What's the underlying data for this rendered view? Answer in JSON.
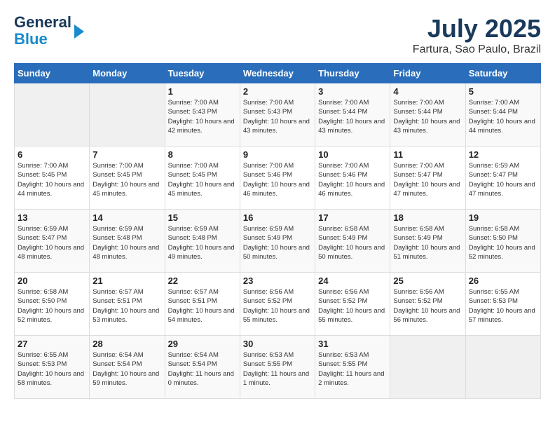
{
  "header": {
    "logo_line1": "General",
    "logo_line2": "Blue",
    "month": "July 2025",
    "location": "Fartura, Sao Paulo, Brazil"
  },
  "weekdays": [
    "Sunday",
    "Monday",
    "Tuesday",
    "Wednesday",
    "Thursday",
    "Friday",
    "Saturday"
  ],
  "weeks": [
    [
      {
        "day": "",
        "info": ""
      },
      {
        "day": "",
        "info": ""
      },
      {
        "day": "1",
        "info": "Sunrise: 7:00 AM\nSunset: 5:43 PM\nDaylight: 10 hours and 42 minutes."
      },
      {
        "day": "2",
        "info": "Sunrise: 7:00 AM\nSunset: 5:43 PM\nDaylight: 10 hours and 43 minutes."
      },
      {
        "day": "3",
        "info": "Sunrise: 7:00 AM\nSunset: 5:44 PM\nDaylight: 10 hours and 43 minutes."
      },
      {
        "day": "4",
        "info": "Sunrise: 7:00 AM\nSunset: 5:44 PM\nDaylight: 10 hours and 43 minutes."
      },
      {
        "day": "5",
        "info": "Sunrise: 7:00 AM\nSunset: 5:44 PM\nDaylight: 10 hours and 44 minutes."
      }
    ],
    [
      {
        "day": "6",
        "info": "Sunrise: 7:00 AM\nSunset: 5:45 PM\nDaylight: 10 hours and 44 minutes."
      },
      {
        "day": "7",
        "info": "Sunrise: 7:00 AM\nSunset: 5:45 PM\nDaylight: 10 hours and 45 minutes."
      },
      {
        "day": "8",
        "info": "Sunrise: 7:00 AM\nSunset: 5:45 PM\nDaylight: 10 hours and 45 minutes."
      },
      {
        "day": "9",
        "info": "Sunrise: 7:00 AM\nSunset: 5:46 PM\nDaylight: 10 hours and 46 minutes."
      },
      {
        "day": "10",
        "info": "Sunrise: 7:00 AM\nSunset: 5:46 PM\nDaylight: 10 hours and 46 minutes."
      },
      {
        "day": "11",
        "info": "Sunrise: 7:00 AM\nSunset: 5:47 PM\nDaylight: 10 hours and 47 minutes."
      },
      {
        "day": "12",
        "info": "Sunrise: 6:59 AM\nSunset: 5:47 PM\nDaylight: 10 hours and 47 minutes."
      }
    ],
    [
      {
        "day": "13",
        "info": "Sunrise: 6:59 AM\nSunset: 5:47 PM\nDaylight: 10 hours and 48 minutes."
      },
      {
        "day": "14",
        "info": "Sunrise: 6:59 AM\nSunset: 5:48 PM\nDaylight: 10 hours and 48 minutes."
      },
      {
        "day": "15",
        "info": "Sunrise: 6:59 AM\nSunset: 5:48 PM\nDaylight: 10 hours and 49 minutes."
      },
      {
        "day": "16",
        "info": "Sunrise: 6:59 AM\nSunset: 5:49 PM\nDaylight: 10 hours and 50 minutes."
      },
      {
        "day": "17",
        "info": "Sunrise: 6:58 AM\nSunset: 5:49 PM\nDaylight: 10 hours and 50 minutes."
      },
      {
        "day": "18",
        "info": "Sunrise: 6:58 AM\nSunset: 5:49 PM\nDaylight: 10 hours and 51 minutes."
      },
      {
        "day": "19",
        "info": "Sunrise: 6:58 AM\nSunset: 5:50 PM\nDaylight: 10 hours and 52 minutes."
      }
    ],
    [
      {
        "day": "20",
        "info": "Sunrise: 6:58 AM\nSunset: 5:50 PM\nDaylight: 10 hours and 52 minutes."
      },
      {
        "day": "21",
        "info": "Sunrise: 6:57 AM\nSunset: 5:51 PM\nDaylight: 10 hours and 53 minutes."
      },
      {
        "day": "22",
        "info": "Sunrise: 6:57 AM\nSunset: 5:51 PM\nDaylight: 10 hours and 54 minutes."
      },
      {
        "day": "23",
        "info": "Sunrise: 6:56 AM\nSunset: 5:52 PM\nDaylight: 10 hours and 55 minutes."
      },
      {
        "day": "24",
        "info": "Sunrise: 6:56 AM\nSunset: 5:52 PM\nDaylight: 10 hours and 55 minutes."
      },
      {
        "day": "25",
        "info": "Sunrise: 6:56 AM\nSunset: 5:52 PM\nDaylight: 10 hours and 56 minutes."
      },
      {
        "day": "26",
        "info": "Sunrise: 6:55 AM\nSunset: 5:53 PM\nDaylight: 10 hours and 57 minutes."
      }
    ],
    [
      {
        "day": "27",
        "info": "Sunrise: 6:55 AM\nSunset: 5:53 PM\nDaylight: 10 hours and 58 minutes."
      },
      {
        "day": "28",
        "info": "Sunrise: 6:54 AM\nSunset: 5:54 PM\nDaylight: 10 hours and 59 minutes."
      },
      {
        "day": "29",
        "info": "Sunrise: 6:54 AM\nSunset: 5:54 PM\nDaylight: 11 hours and 0 minutes."
      },
      {
        "day": "30",
        "info": "Sunrise: 6:53 AM\nSunset: 5:55 PM\nDaylight: 11 hours and 1 minute."
      },
      {
        "day": "31",
        "info": "Sunrise: 6:53 AM\nSunset: 5:55 PM\nDaylight: 11 hours and 2 minutes."
      },
      {
        "day": "",
        "info": ""
      },
      {
        "day": "",
        "info": ""
      }
    ]
  ]
}
